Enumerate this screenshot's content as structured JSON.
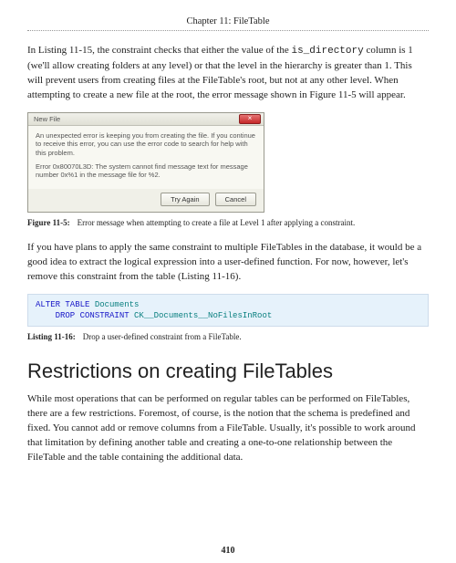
{
  "chapter_header": "Chapter 11: FileTable",
  "para1_a": "In Listing 11-15, the constraint checks that either the value of the ",
  "para1_mono": "is_directory",
  "para1_b": " column is 1 (we'll allow creating folders at any level) or that the level in the hierarchy is greater than 1. This will prevent users from creating files at the FileTable's root, but not at any other level. When attempting to create a new file at the root, the error message shown in Figure 11-5 will appear.",
  "dialog": {
    "title": "New File",
    "close": "×",
    "body1": "An unexpected error is keeping you from creating the file. If you continue to receive this error, you can use the error code to search for help with this problem.",
    "body2": "Error 0x80070L3D: The system cannot find message text for message number 0x%1 in the message file for %2.",
    "btn_try": "Try Again",
    "btn_cancel": "Cancel"
  },
  "fig5_label": "Figure 11-5:",
  "fig5_text": "Error message when attempting to create a file at Level 1 after applying a constraint.",
  "para2": "If you have plans to apply the same constraint to multiple FileTables in the database, it would be a good idea to extract the logical expression into a user-defined function. For now, however, let's remove this constraint from the table (Listing 11-16).",
  "code": {
    "line1_kw1": "ALTER TABLE",
    "line1_obj": " Documents",
    "line2_indent": "    ",
    "line2_kw": "DROP CONSTRAINT",
    "line2_obj": " CK__Documents__NoFilesInRoot"
  },
  "list16_label": "Listing 11-16:",
  "list16_text": "Drop a user-defined constraint from a FileTable.",
  "heading": "Restrictions on creating FileTables",
  "para3": "While most operations that can be performed on regular tables can be performed on FileTables, there are a few restrictions. Foremost, of course, is the notion that the schema is predefined and fixed. You cannot add or remove columns from a FileTable. Usually, it's possible to work around that limitation by defining another table and creating a one-to-one relationship between the FileTable and the table containing the additional data.",
  "page_num": "410"
}
